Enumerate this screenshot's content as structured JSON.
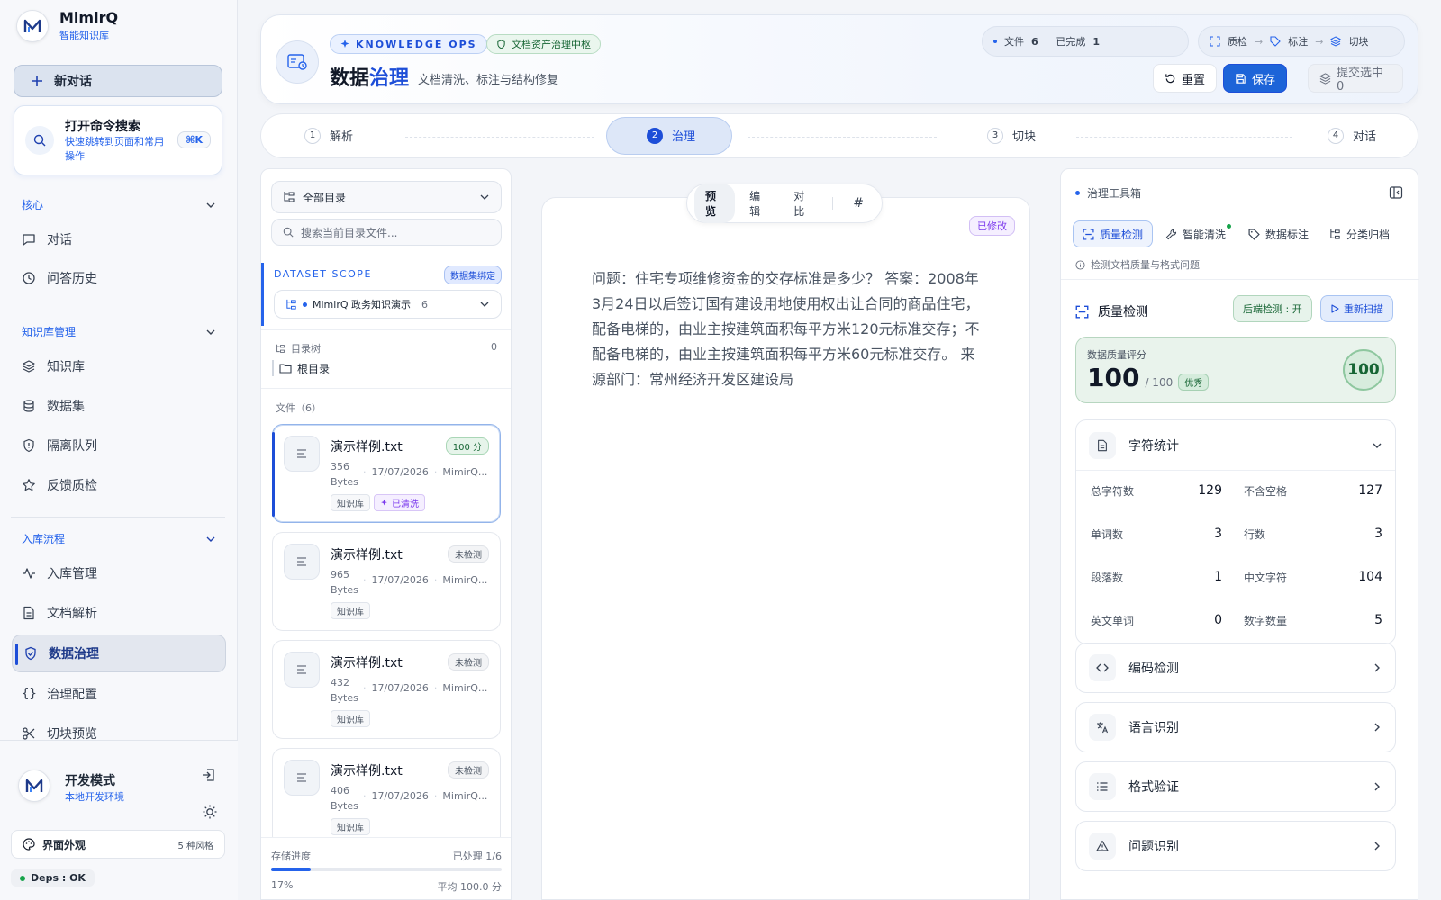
{
  "brand": {
    "name": "MimirQ",
    "subtitle": "智能知识库"
  },
  "sidebar": {
    "new_chat": "新对话",
    "command": {
      "title": "打开命令搜索",
      "desc": "快速跳转到页面和常用操作",
      "shortcut": "⌘K"
    },
    "sections": [
      {
        "label": "核心",
        "items": [
          "对话",
          "问答历史"
        ]
      },
      {
        "label": "知识库管理",
        "items": [
          "知识库",
          "数据集",
          "隔离队列",
          "反馈质检"
        ]
      },
      {
        "label": "入库流程",
        "items": [
          "入库管理",
          "文档解析",
          "数据治理",
          "治理配置",
          "切块预览"
        ]
      }
    ],
    "active_item": "数据治理",
    "dev": {
      "title": "开发模式",
      "subtitle": "本地开发环境"
    },
    "appearance": {
      "label": "界面外观",
      "count": "5 种风格"
    },
    "deps": "Deps : OK"
  },
  "header": {
    "badge": "KNOWLEDGE OPS",
    "badge2": "文档资产治理中枢",
    "title_a": "数据",
    "title_b": "治理",
    "subtitle": "文档清洗、标注与结构修复",
    "stats": {
      "files_label": "文件",
      "files": "6",
      "done_label": "已完成",
      "done": "1"
    },
    "flow": [
      "质检",
      "标注",
      "切块"
    ],
    "reset": "重置",
    "save": "保存",
    "submit": "提交选中 0"
  },
  "stepper": [
    {
      "num": "1",
      "label": "解析"
    },
    {
      "num": "2",
      "label": "治理"
    },
    {
      "num": "3",
      "label": "切块"
    },
    {
      "num": "4",
      "label": "对话"
    }
  ],
  "filepanel": {
    "dir_select": "全部目录",
    "search_placeholder": "搜索当前目录文件...",
    "scope_label": "DATASET SCOPE",
    "scope_badge": "数据集绑定",
    "dataset": "MimirQ 政务知识演示",
    "dataset_count": "6",
    "tree_label": "目录树",
    "tree_count": "0",
    "root": "根目录",
    "files_label": "文件（6）",
    "files": [
      {
        "name": "演示样例.txt",
        "badge": "100 分",
        "size": "356",
        "unit": "Bytes",
        "date": "17/07/2026",
        "owner": "MimirQ...",
        "tags": [
          "知识库",
          "已清洗"
        ]
      },
      {
        "name": "演示样例.txt",
        "badge": "未检测",
        "size": "965",
        "unit": "Bytes",
        "date": "17/07/2026",
        "owner": "MimirQ...",
        "tags": [
          "知识库"
        ]
      },
      {
        "name": "演示样例.txt",
        "badge": "未检测",
        "size": "432",
        "unit": "Bytes",
        "date": "17/07/2026",
        "owner": "MimirQ...",
        "tags": [
          "知识库"
        ]
      },
      {
        "name": "演示样例.txt",
        "badge": "未检测",
        "size": "406",
        "unit": "Bytes",
        "date": "17/07/2026",
        "owner": "MimirQ...",
        "tags": [
          "知识库"
        ]
      }
    ],
    "progress": {
      "label": "存储进度",
      "processed": "已处理 1/6",
      "percent_text": "17%",
      "avg": "平均 100.0 分",
      "fraction": 0.17
    }
  },
  "editor": {
    "tabs": [
      "预览",
      "编辑",
      "对比"
    ],
    "hash": "#",
    "modified": "已修改",
    "content": "问题：住宅专项维修资金的交存标准是多少？ 答案：2008年3月24日以后签订国有建设用地使用权出让合同的商品住宅，配备电梯的，由业主按建筑面积每平方米120元标准交存；不配备电梯的，由业主按建筑面积每平方米60元标准交存。 来源部门：常州经济开发区建设局"
  },
  "toolbox": {
    "title": "治理工具箱",
    "tabs": [
      "质量检测",
      "智能清洗",
      "数据标注",
      "分类归档"
    ],
    "hint": "检测文档质量与格式问题",
    "section_title": "质量检测",
    "backend": "后端检测 : 开",
    "rescan": "重新扫描",
    "score_label": "数据质量评分",
    "score": "100",
    "score_total": "/ 100",
    "grade": "优秀",
    "stats_title": "字符统计",
    "stats": [
      {
        "label": "总字符数",
        "value": "129"
      },
      {
        "label": "不含空格",
        "value": "127"
      },
      {
        "label": "单词数",
        "value": "3"
      },
      {
        "label": "行数",
        "value": "3"
      },
      {
        "label": "段落数",
        "value": "1"
      },
      {
        "label": "中文字符",
        "value": "104"
      },
      {
        "label": "英文单词",
        "value": "0"
      },
      {
        "label": "数字数量",
        "value": "5"
      }
    ],
    "sections": [
      "编码检测",
      "语言识别",
      "格式验证",
      "问题识别"
    ]
  },
  "colors": {
    "accent": "#2563eb",
    "success": "#16a34a",
    "purple": "#7c3aed"
  }
}
